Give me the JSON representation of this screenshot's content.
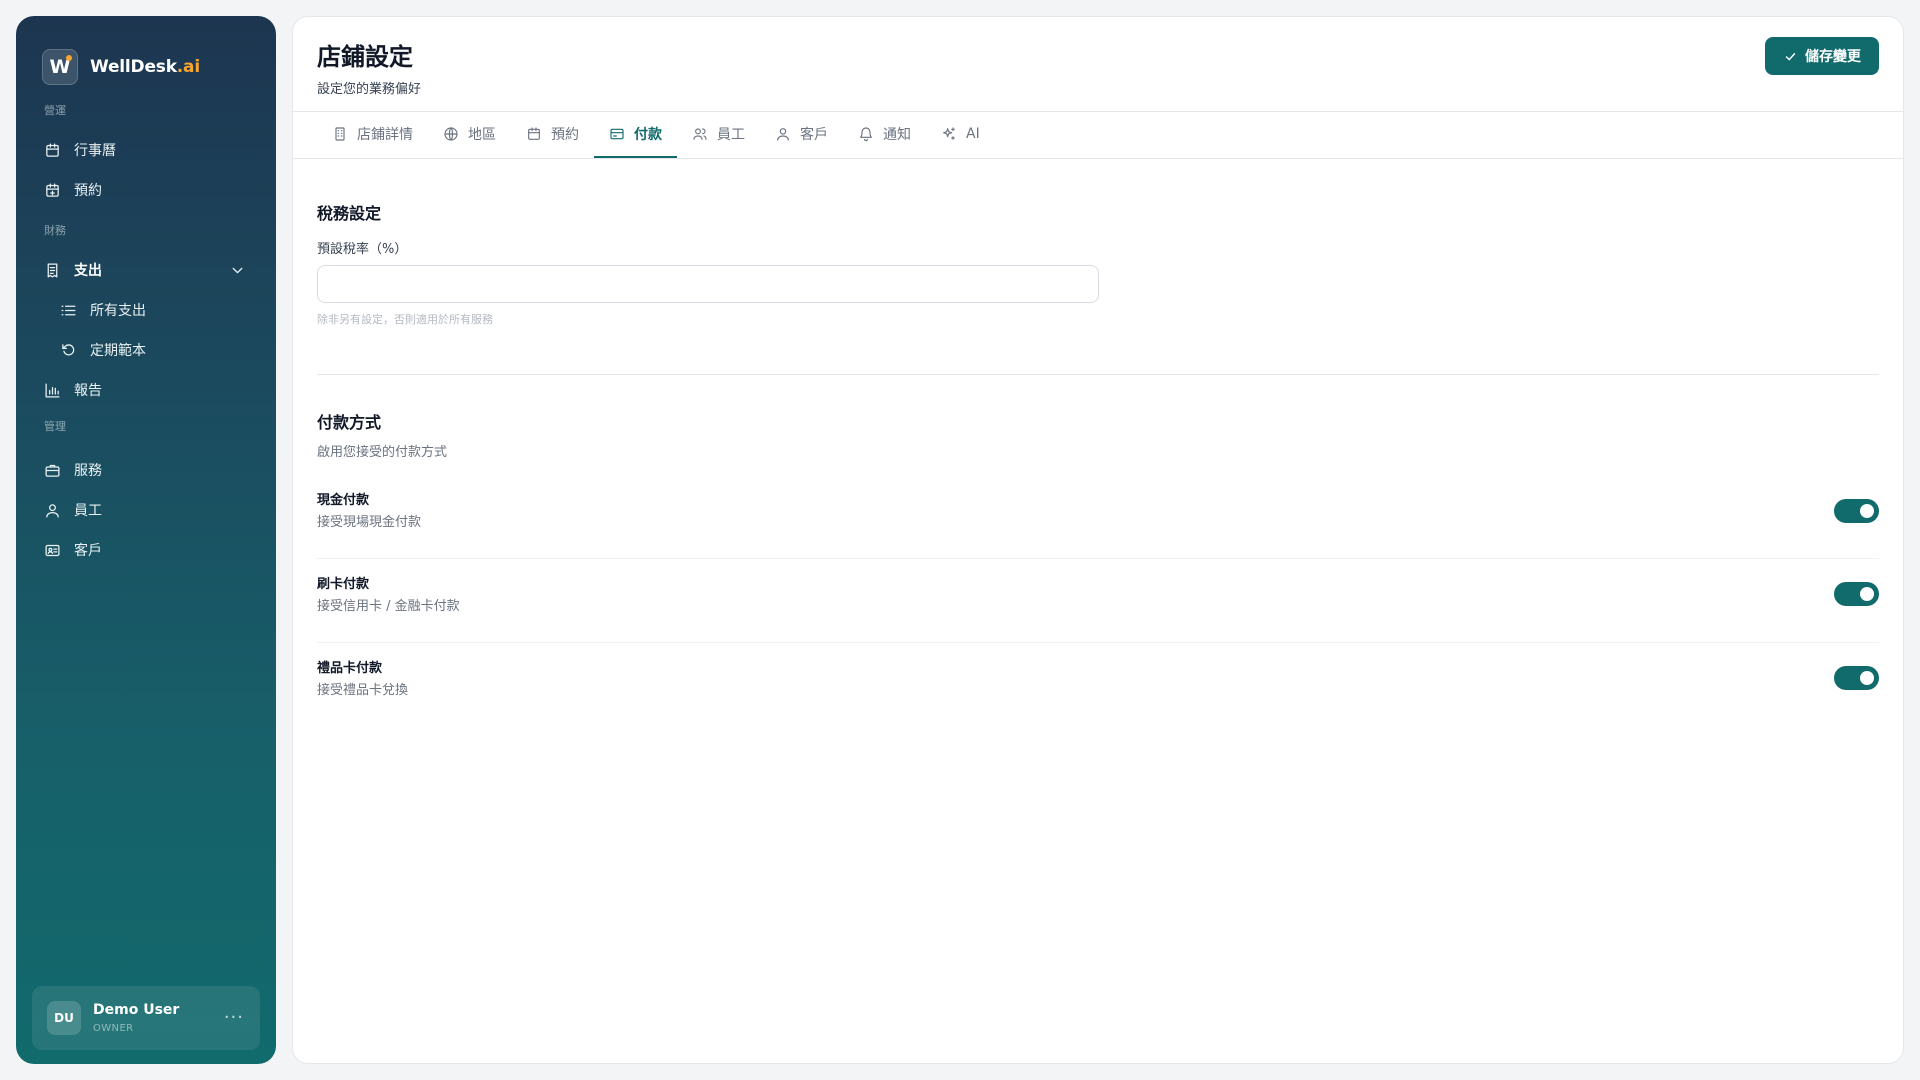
{
  "brand": {
    "name_main": "WellDesk",
    "name_accent": ".ai",
    "logo_letter": "W",
    "accent_color": "#f6a530"
  },
  "sidebar": {
    "sections": [
      {
        "label": "營運"
      },
      {
        "label": "財務"
      },
      {
        "label": "管理"
      }
    ],
    "items": [
      {
        "label": "行事曆",
        "icon": "calendar-icon"
      },
      {
        "label": "預約",
        "icon": "calendar-plus-icon"
      },
      {
        "label": "支出",
        "icon": "receipt-icon",
        "expanded": true
      },
      {
        "label": "所有支出",
        "icon": "list-icon"
      },
      {
        "label": "定期範本",
        "icon": "refresh-icon"
      },
      {
        "label": "報告",
        "icon": "bar-chart-icon"
      },
      {
        "label": "服務",
        "icon": "briefcase-icon"
      },
      {
        "label": "員工",
        "icon": "user-icon"
      },
      {
        "label": "客戶",
        "icon": "contact-card-icon"
      }
    ]
  },
  "user": {
    "initials": "DU",
    "name": "Demo User",
    "role": "OWNER"
  },
  "header": {
    "title": "店鋪設定",
    "subtitle": "設定您的業務偏好",
    "save_label": "儲存變更"
  },
  "tabs": [
    {
      "label": "店鋪詳情",
      "icon": "building-icon"
    },
    {
      "label": "地區",
      "icon": "globe-icon"
    },
    {
      "label": "預約",
      "icon": "calendar-icon"
    },
    {
      "label": "付款",
      "icon": "credit-card-icon",
      "active": true
    },
    {
      "label": "員工",
      "icon": "users-icon"
    },
    {
      "label": "客戶",
      "icon": "user-icon"
    },
    {
      "label": "通知",
      "icon": "bell-icon"
    },
    {
      "label": "AI",
      "icon": "sparkles-icon"
    }
  ],
  "tax": {
    "title": "稅務設定",
    "rate_label": "預設稅率（%）",
    "rate_value": "",
    "hint": "除非另有設定，否則適用於所有服務"
  },
  "payment": {
    "title": "付款方式",
    "subtitle": "啟用您接受的付款方式",
    "methods": [
      {
        "title": "現金付款",
        "desc": "接受現場現金付款",
        "enabled": true
      },
      {
        "title": "刷卡付款",
        "desc": "接受信用卡 / 金融卡付款",
        "enabled": true
      },
      {
        "title": "禮品卡付款",
        "desc": "接受禮品卡兌換",
        "enabled": true
      }
    ]
  },
  "colors": {
    "primary": "#116a6c",
    "sidebar_top": "#1d3550",
    "sidebar_bottom": "#116a6c"
  }
}
